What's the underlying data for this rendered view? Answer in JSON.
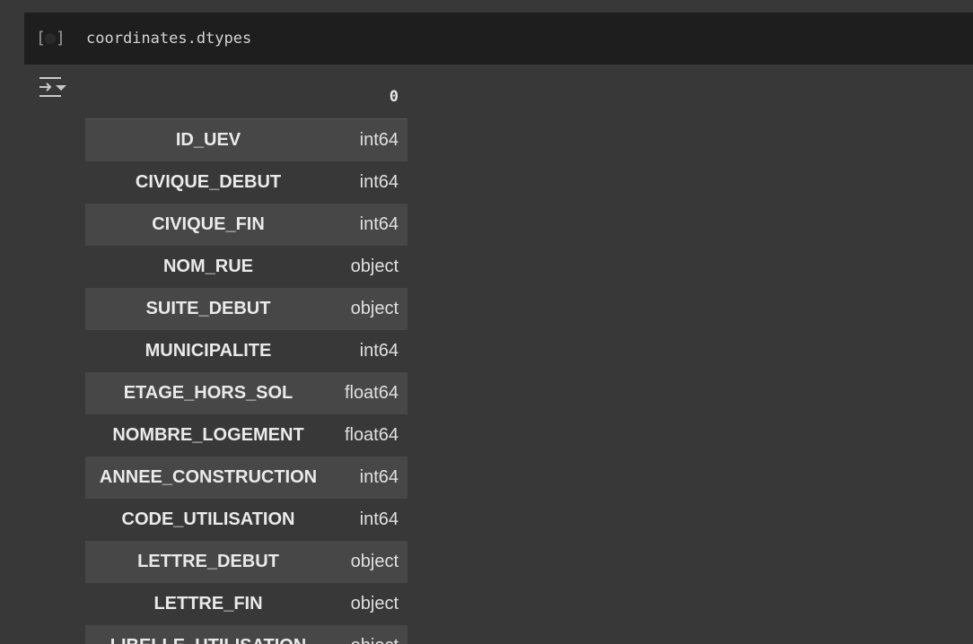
{
  "cell": {
    "code": "coordinates.dtypes",
    "run_bracket_left": "[",
    "run_bracket_right": "]"
  },
  "output": {
    "header": "0",
    "rows": [
      {
        "name": "ID_UEV",
        "dtype": "int64"
      },
      {
        "name": "CIVIQUE_DEBUT",
        "dtype": "int64"
      },
      {
        "name": "CIVIQUE_FIN",
        "dtype": "int64"
      },
      {
        "name": "NOM_RUE",
        "dtype": "object"
      },
      {
        "name": "SUITE_DEBUT",
        "dtype": "object"
      },
      {
        "name": "MUNICIPALITE",
        "dtype": "int64"
      },
      {
        "name": "ETAGE_HORS_SOL",
        "dtype": "float64"
      },
      {
        "name": "NOMBRE_LOGEMENT",
        "dtype": "float64"
      },
      {
        "name": "ANNEE_CONSTRUCTION",
        "dtype": "int64"
      },
      {
        "name": "CODE_UTILISATION",
        "dtype": "int64"
      },
      {
        "name": "LETTRE_DEBUT",
        "dtype": "object"
      },
      {
        "name": "LETTRE_FIN",
        "dtype": "object"
      },
      {
        "name": "LIBELLE_UTILISATION",
        "dtype": "object"
      }
    ]
  },
  "icons": {
    "run_indicator": "run-cell-icon",
    "output_toggle": "output-actions-icon"
  },
  "colors": {
    "page_bg": "#383838",
    "cell_bg": "#1e1e1e",
    "row_alt_bg": "#474747",
    "text": "#eaeaea"
  }
}
